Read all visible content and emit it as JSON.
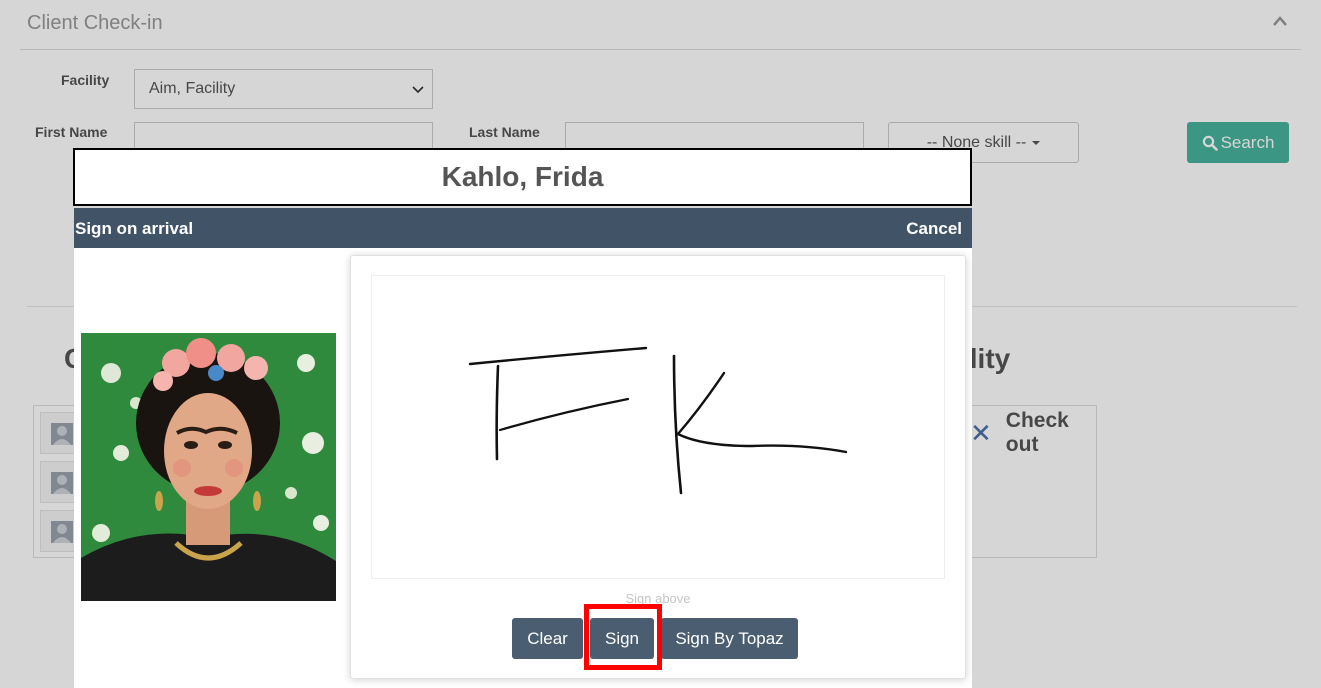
{
  "panel": {
    "title": "Client Check-in"
  },
  "filters": {
    "facility_label": "Facility",
    "facility_value": "Aim, Facility",
    "first_name_label": "First Name",
    "first_name_value": "",
    "last_name_label": "Last Name",
    "last_name_value": "",
    "skill_value": "-- None skill --",
    "search_label": "Search"
  },
  "background": {
    "heading_left": "C",
    "heading_right": "ility",
    "checkout_label": "Check out"
  },
  "modal": {
    "client_name": "Kahlo, Frida",
    "bar_title": "Sign on arrival",
    "cancel_label": "Cancel",
    "signature_text": "FK",
    "sign_hint": "Sign above",
    "buttons": {
      "clear": "Clear",
      "sign": "Sign",
      "topaz": "Sign By Topaz"
    }
  },
  "colors": {
    "modal_bar": "#415467",
    "button": "#4b5e71",
    "search_button": "#47b39d",
    "highlight": "#ff0000"
  },
  "icons": [
    "chevron-up-icon",
    "chevron-down-icon",
    "search-icon",
    "user-avatar-icon",
    "close-icon"
  ]
}
